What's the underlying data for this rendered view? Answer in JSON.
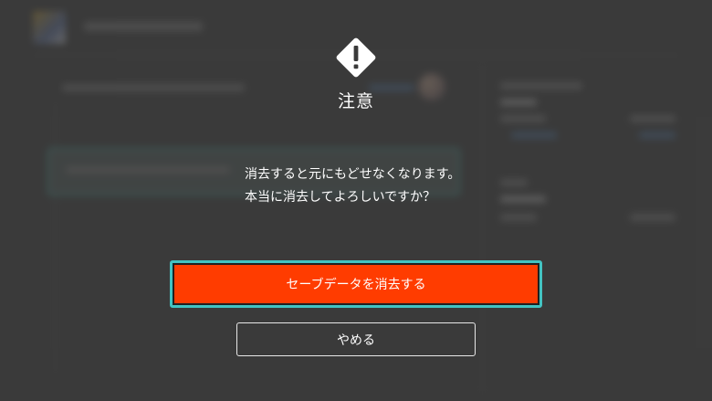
{
  "dialog": {
    "icon": "warning-diamond-icon",
    "title": "注意",
    "message_lines": [
      "消去すると元にもどせなくなります。",
      "本当に消去してよろしいですか？"
    ],
    "confirm_label": "セーブデータを消去する",
    "cancel_label": "やめる"
  },
  "colors": {
    "confirm_button": "#ff3c00",
    "focus_outline": "#43c3c2",
    "text": "#ffffff"
  }
}
